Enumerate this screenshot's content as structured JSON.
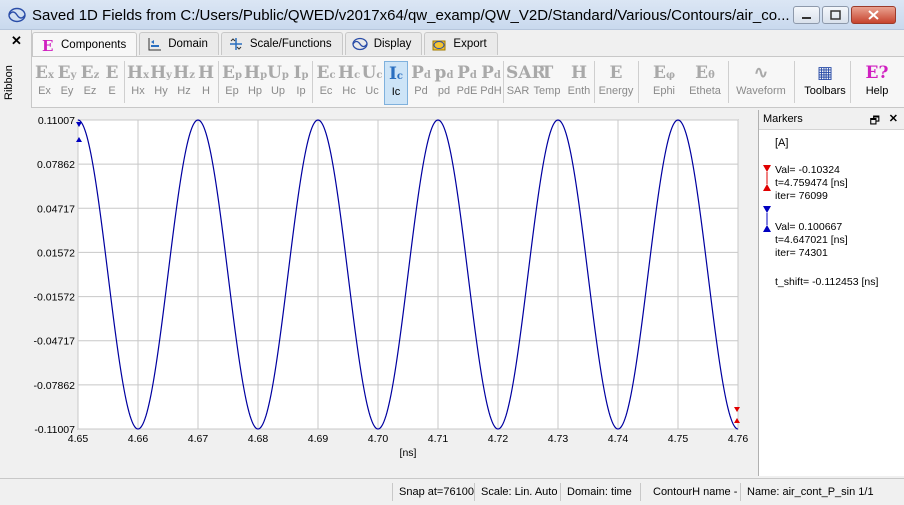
{
  "window": {
    "title": "Saved 1D Fields from C:/Users/Public/QWED/v2017x64/qw_examp/QW_V2D/Standard/Various/Contours/air_co...",
    "icon": "wave-icon"
  },
  "ribbon_side": {
    "close_glyph": "✕",
    "label": "Ribbon"
  },
  "tabs": [
    {
      "label": "Components",
      "icon": "E-icon",
      "active": true
    },
    {
      "label": "Domain",
      "icon": "domain-icon"
    },
    {
      "label": "Scale/Functions",
      "icon": "scale-icon"
    },
    {
      "label": "Display",
      "icon": "display-icon"
    },
    {
      "label": "Export",
      "icon": "export-icon"
    }
  ],
  "toolbar": {
    "buttons": [
      {
        "glyph": "E",
        "sub": "x",
        "label": "Ex"
      },
      {
        "glyph": "E",
        "sub": "y",
        "label": "Ey"
      },
      {
        "glyph": "E",
        "sub": "z",
        "label": "Ez"
      },
      {
        "glyph": "E",
        "sub": "",
        "label": "E"
      },
      {
        "glyph": "H",
        "sub": "x",
        "label": "Hx"
      },
      {
        "glyph": "H",
        "sub": "y",
        "label": "Hy"
      },
      {
        "glyph": "H",
        "sub": "z",
        "label": "Hz"
      },
      {
        "glyph": "H",
        "sub": "",
        "label": "H"
      },
      {
        "glyph": "E",
        "sub": "p",
        "label": "Ep"
      },
      {
        "glyph": "H",
        "sub": "p",
        "label": "Hp"
      },
      {
        "glyph": "U",
        "sub": "p",
        "label": "Up"
      },
      {
        "glyph": "I",
        "sub": "p",
        "label": "Ip"
      },
      {
        "glyph": "E",
        "sub": "c",
        "label": "Ec"
      },
      {
        "glyph": "H",
        "sub": "c",
        "label": "Hc"
      },
      {
        "glyph": "U",
        "sub": "c",
        "label": "Uc"
      },
      {
        "glyph": "I",
        "sub": "c",
        "label": "Ic",
        "active": true
      },
      {
        "glyph": "P",
        "sub": "d",
        "label": "Pd"
      },
      {
        "glyph": "p",
        "sub": "d",
        "label": "pd"
      },
      {
        "glyph": "P",
        "sub": "d",
        "label": "PdE"
      },
      {
        "glyph": "P",
        "sub": "d",
        "label": "PdH"
      },
      {
        "glyph": "SAR",
        "sub": "",
        "label": "SAR"
      },
      {
        "glyph": "T",
        "sub": "",
        "label": "Temp"
      },
      {
        "glyph": "H",
        "sub": "",
        "label": "Enth"
      },
      {
        "glyph": "E",
        "sub": "",
        "label": "Energy"
      },
      {
        "glyph": "E",
        "sub": "φ",
        "label": "Ephi"
      },
      {
        "glyph": "E",
        "sub": "θ",
        "label": "Etheta"
      },
      {
        "glyph": "∿",
        "sub": "",
        "label": "Waveform"
      },
      {
        "glyph": "▦",
        "sub": "",
        "label": "Toolbars",
        "dark": true
      },
      {
        "glyph": "E?",
        "sub": "",
        "label": "Help",
        "dark": true
      }
    ]
  },
  "markers_panel": {
    "title": "Markers",
    "pin_glyph": "🗗",
    "close_glyph": "✕",
    "unit": "[A]",
    "marker1": {
      "val": "Val= -0.10324",
      "t": "t=4.759474 [ns]",
      "iter": "iter= 76099",
      "color": "#e00000"
    },
    "marker2": {
      "val": "Val= 0.100667",
      "t": "t=4.647021 [ns]",
      "iter": "iter= 74301",
      "color": "#0000c0"
    },
    "t_shift": "t_shift= -0.112453 [ns]"
  },
  "status": {
    "snap": "Snap at=76100",
    "scale": "Scale: Lin. Auto",
    "domain": "Domain: time",
    "contour": "ContourH name -",
    "name": "Name:  air_cont_P_sin  1/1"
  },
  "chart_data": {
    "type": "line",
    "xlabel": "[ns]",
    "ylabel": "",
    "xlim": [
      4.65,
      4.76
    ],
    "ylim": [
      -0.11007,
      0.11007
    ],
    "x_ticks": [
      "4.65",
      "4.66",
      "4.67",
      "4.68",
      "4.69",
      "4.70",
      "4.71",
      "4.72",
      "4.73",
      "4.74",
      "4.75",
      "4.76"
    ],
    "y_ticks": [
      "0.11007",
      "0.07862",
      "0.04717",
      "0.01572",
      "-0.01572",
      "-0.04717",
      "-0.07862",
      "-0.11007"
    ],
    "grid": true,
    "series": [
      {
        "amplitude": 0.11007,
        "period_ns": 0.02,
        "peak_x": 4.65,
        "color": "#0000a0"
      }
    ],
    "sample_points": {
      "x": [
        4.65,
        4.655,
        4.66,
        4.665,
        4.67,
        4.675,
        4.68,
        4.685,
        4.69,
        4.695,
        4.7,
        4.705,
        4.71,
        4.715,
        4.72,
        4.725,
        4.73,
        4.735,
        4.74,
        4.745,
        4.75,
        4.755,
        4.76
      ],
      "y": [
        0.11007,
        0,
        -0.11007,
        0,
        0.11007,
        0,
        -0.11007,
        0,
        0.11007,
        0,
        -0.11007,
        0,
        0.11007,
        0,
        -0.11007,
        0,
        0.11007,
        0,
        -0.11007,
        0,
        0.11007,
        0,
        -0.11007
      ]
    }
  }
}
